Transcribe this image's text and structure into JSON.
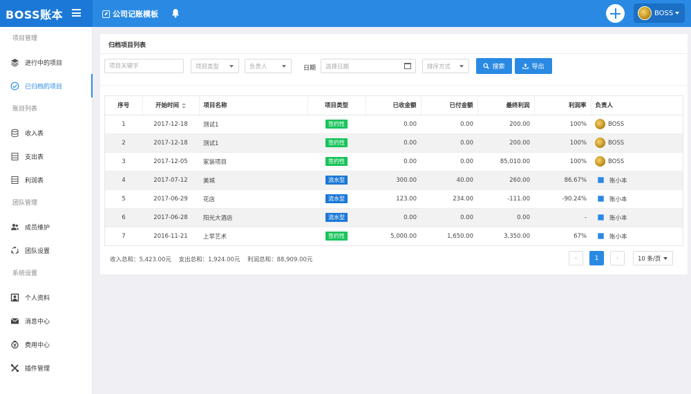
{
  "header": {
    "brand": "BOSS账本",
    "module_link": "公司记账模板",
    "user_name": "BOSS"
  },
  "sidebar": {
    "groups": [
      {
        "label": "项目管理",
        "items": [
          {
            "label": "进行中的项目",
            "icon": "layers-icon",
            "active": false
          },
          {
            "label": "已归档的项目",
            "icon": "check-circle-icon",
            "active": true
          }
        ]
      },
      {
        "label": "账目列表",
        "items": [
          {
            "label": "收入表",
            "icon": "database-icon",
            "active": false
          },
          {
            "label": "支出表",
            "icon": "database-icon",
            "active": false
          },
          {
            "label": "利润表",
            "icon": "database-icon",
            "active": false
          }
        ]
      },
      {
        "label": "团队管理",
        "items": [
          {
            "label": "成员维护",
            "icon": "users-icon",
            "active": false
          },
          {
            "label": "团队设置",
            "icon": "team-settings-icon",
            "active": false
          }
        ]
      },
      {
        "label": "系统设置",
        "items": [
          {
            "label": "个人资料",
            "icon": "profile-icon",
            "active": false
          },
          {
            "label": "消息中心",
            "icon": "mail-icon",
            "active": false
          },
          {
            "label": "费用中心",
            "icon": "fee-icon",
            "active": false
          },
          {
            "label": "插件管理",
            "icon": "tools-icon",
            "active": false
          }
        ]
      }
    ]
  },
  "panel": {
    "title": "归档项目列表"
  },
  "filters": {
    "keyword_placeholder": "项目关键字",
    "type_placeholder": "项目类型",
    "owner_placeholder": "负责人",
    "date_label": "日期",
    "date_placeholder": "选择日期",
    "sort_placeholder": "排序方式",
    "search_label": "搜索",
    "export_label": "导出"
  },
  "table": {
    "headers": [
      "序号",
      "开始时间",
      "项目名称",
      "项目类型",
      "已收金额",
      "已付金额",
      "最终利润",
      "利润率",
      "负责人"
    ],
    "rows": [
      {
        "no": "1",
        "start": "2017-12-18",
        "name": "测试1",
        "type": "签约性",
        "type_color": "green",
        "received": "0.00",
        "paid": "0.00",
        "profit": "200.00",
        "rate": "100%",
        "owner": "BOSS",
        "owner_kind": "avatar"
      },
      {
        "no": "2",
        "start": "2017-12-18",
        "name": "测试1",
        "type": "签约性",
        "type_color": "green",
        "received": "0.00",
        "paid": "0.00",
        "profit": "200.00",
        "rate": "100%",
        "owner": "BOSS",
        "owner_kind": "avatar"
      },
      {
        "no": "3",
        "start": "2017-12-05",
        "name": "家装项目",
        "type": "签约性",
        "type_color": "green",
        "received": "0.00",
        "paid": "0.00",
        "profit": "85,010.00",
        "rate": "100%",
        "owner": "BOSS",
        "owner_kind": "avatar"
      },
      {
        "no": "4",
        "start": "2017-07-12",
        "name": "美城",
        "type": "流水型",
        "type_color": "blue",
        "received": "300.00",
        "paid": "40.00",
        "profit": "260.00",
        "rate": "86.67%",
        "owner": "账小本",
        "owner_kind": "icon"
      },
      {
        "no": "5",
        "start": "2017-06-29",
        "name": "花店",
        "type": "流水型",
        "type_color": "blue",
        "received": "123.00",
        "paid": "234.00",
        "profit": "-111.00",
        "rate": "-90.24%",
        "owner": "账小本",
        "owner_kind": "icon"
      },
      {
        "no": "6",
        "start": "2017-06-28",
        "name": "阳光大酒店",
        "type": "流水型",
        "type_color": "blue",
        "received": "0.00",
        "paid": "0.00",
        "profit": "0.00",
        "rate": "-",
        "owner": "账小本",
        "owner_kind": "icon"
      },
      {
        "no": "7",
        "start": "2016-11-21",
        "name": "上早艺术",
        "type": "签约性",
        "type_color": "green",
        "received": "5,000.00",
        "paid": "1,650.00",
        "profit": "3,350.00",
        "rate": "67%",
        "owner": "账小本",
        "owner_kind": "icon"
      }
    ]
  },
  "summary": {
    "income": "收入总和：5,423.00元",
    "expense": "支出总和：1,924.00元",
    "profit": "利润总和：88,909.00元"
  },
  "pagination": {
    "prev": "‹",
    "current": "1",
    "next": "›",
    "page_size": "10 条/页"
  }
}
